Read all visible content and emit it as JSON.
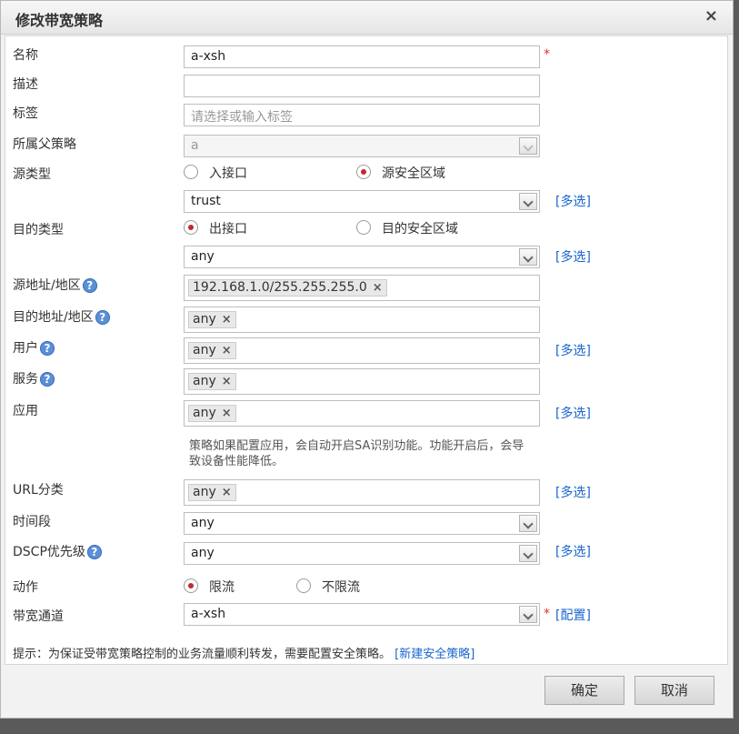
{
  "dialog": {
    "title": "修改带宽策略",
    "close": "×"
  },
  "labels": {
    "name": "名称",
    "desc": "描述",
    "tag": "标签",
    "parent": "所属父策略",
    "src_type": "源类型",
    "dst_type": "目的类型",
    "src_addr": "源地址/地区",
    "dst_addr": "目的地址/地区",
    "user": "用户",
    "service": "服务",
    "app": "应用",
    "url": "URL分类",
    "time": "时间段",
    "dscp": "DSCP优先级",
    "action": "动作",
    "channel": "带宽通道"
  },
  "fields": {
    "name": "a-xsh",
    "desc": "",
    "tag_placeholder": "请选择或输入标签",
    "parent": "a",
    "src_zone": "trust",
    "dst_iface": "any",
    "src_addr_tag": "192.168.1.0/255.255.255.0",
    "dst_addr_tag": "any",
    "user_tag": "any",
    "service_tag": "any",
    "app_tag": "any",
    "url_tag": "any",
    "time": "any",
    "dscp": "any",
    "channel": "a-xsh"
  },
  "radios": {
    "src_iface": "入接口",
    "src_zone": "源安全区域",
    "dst_iface": "出接口",
    "dst_zone": "目的安全区域",
    "limit": "限流",
    "no_limit": "不限流"
  },
  "links": {
    "multi": "[多选]",
    "config": "[配置]",
    "new_policy": "[新建安全策略]"
  },
  "help": "?",
  "tag_close": "×",
  "required": "*",
  "app_note": "策略如果配置应用，会自动开启SA识别功能。功能开启后，会导致设备性能降低。",
  "tip": "提示：为保证受带宽策略控制的业务流量顺利转发，需要配置安全策略。",
  "buttons": {
    "ok": "确定",
    "cancel": "取消"
  }
}
